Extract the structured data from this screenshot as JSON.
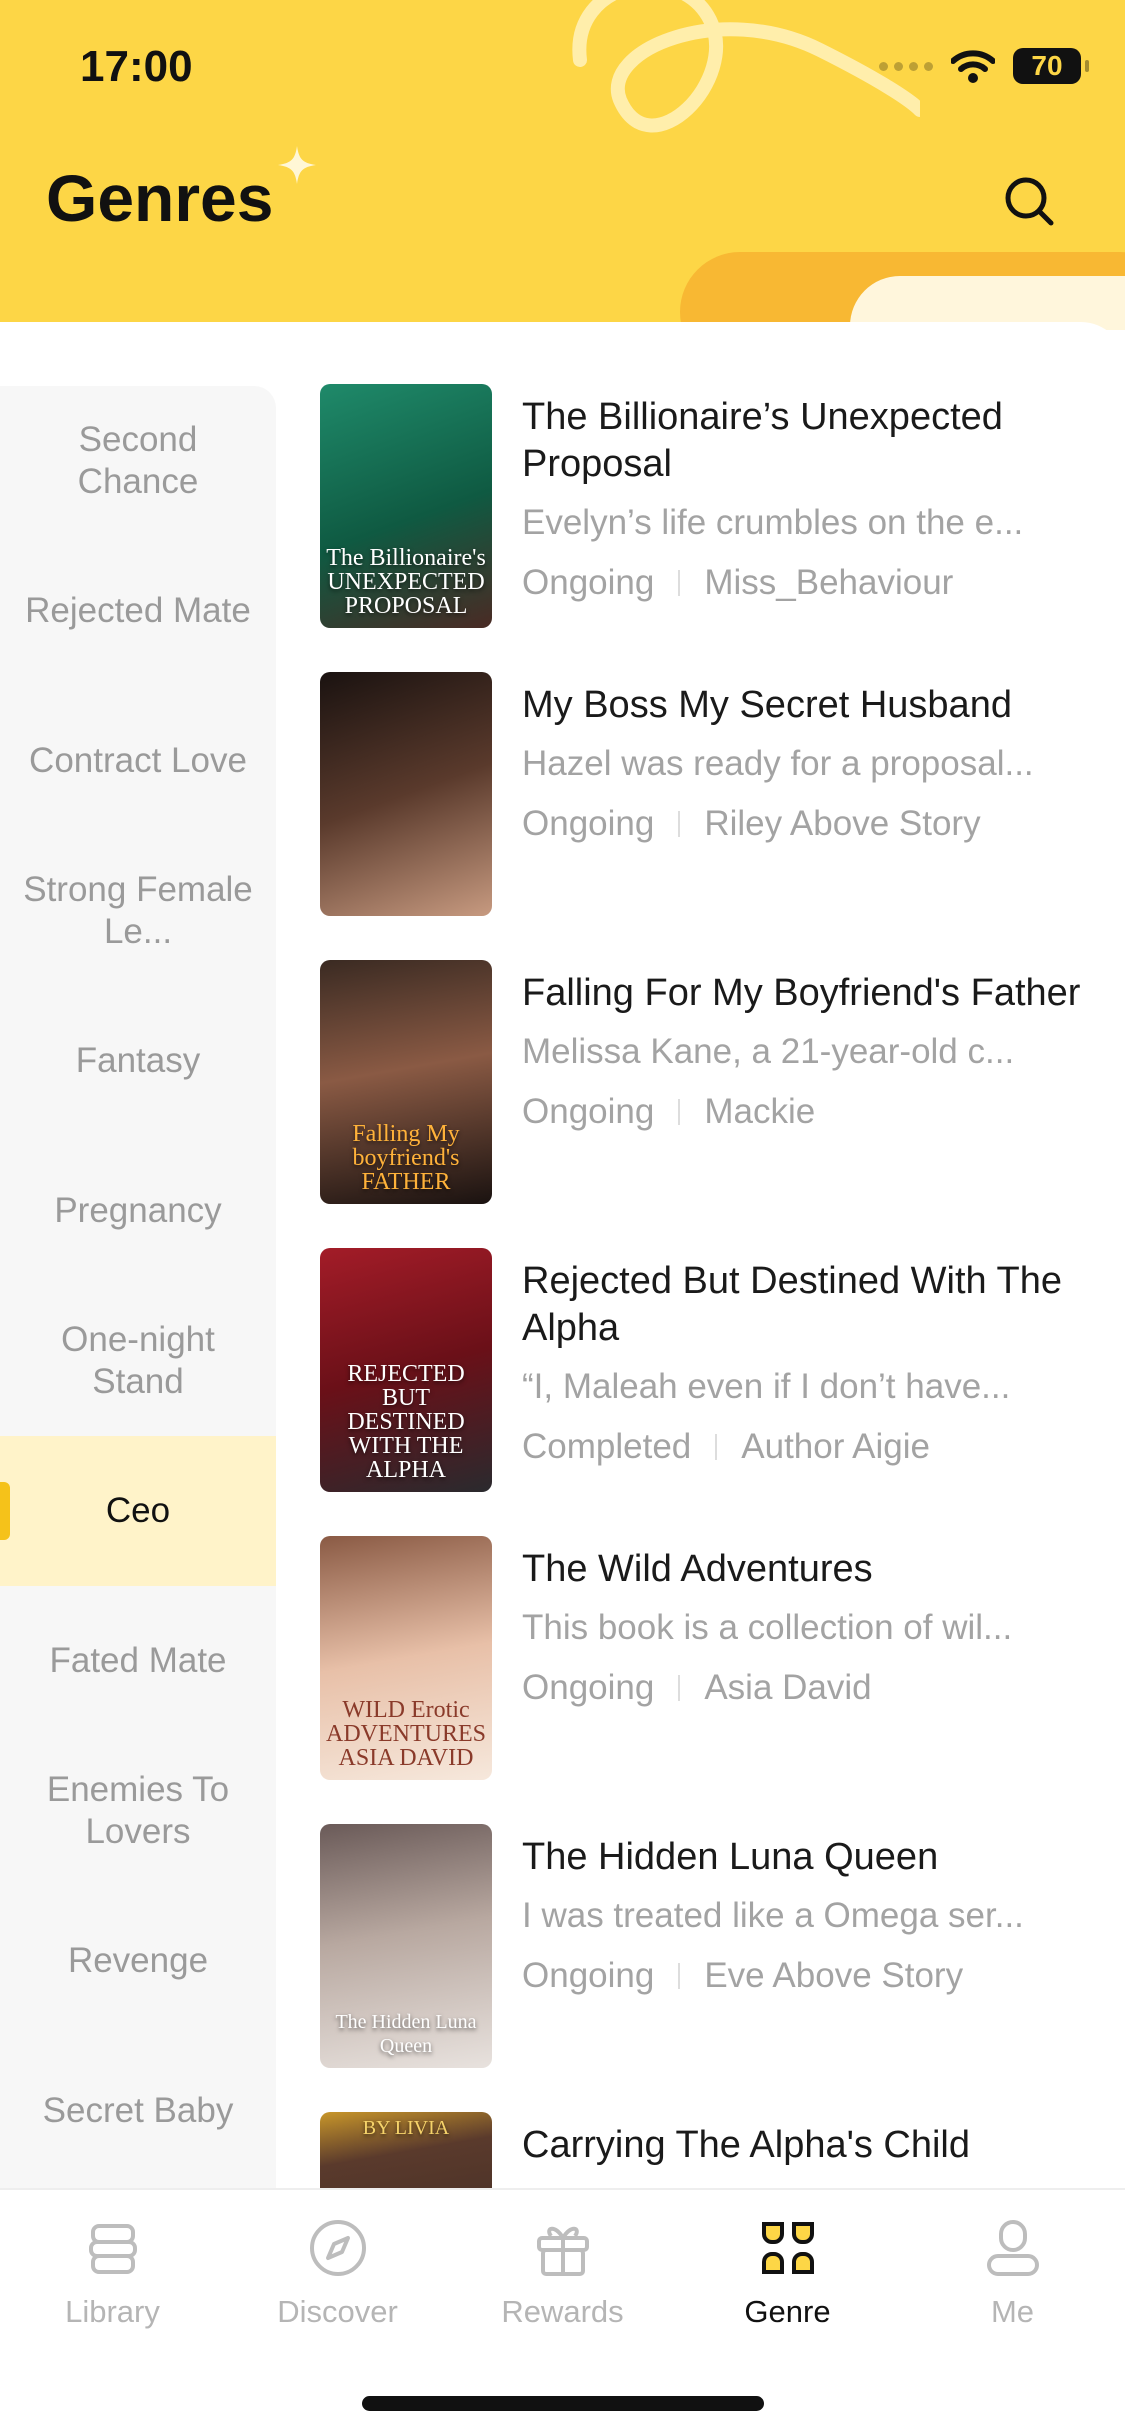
{
  "status_bar": {
    "time": "17:00",
    "battery": "70"
  },
  "header": {
    "title": "Genres"
  },
  "icons": {
    "search": "search-icon",
    "wifi": "wifi-icon",
    "battery": "battery-icon"
  },
  "colors": {
    "accent": "#fdd646",
    "accent_dark": "#f5c21a",
    "active_bg": "#fff3c9",
    "text_muted": "#a3a3a3"
  },
  "genres": [
    {
      "label": "Second Chance",
      "active": false
    },
    {
      "label": "Rejected Mate",
      "active": false
    },
    {
      "label": "Contract Love",
      "active": false
    },
    {
      "label": "Strong Female Le...",
      "active": false
    },
    {
      "label": "Fantasy",
      "active": false
    },
    {
      "label": "Pregnancy",
      "active": false
    },
    {
      "label": "One-night Stand",
      "active": false
    },
    {
      "label": "Ceo",
      "active": true
    },
    {
      "label": "Fated Mate",
      "active": false
    },
    {
      "label": "Enemies To Lovers",
      "active": false
    },
    {
      "label": "Revenge",
      "active": false
    },
    {
      "label": "Secret Baby",
      "active": false
    }
  ],
  "books": [
    {
      "title": "The Billionaire’s Unexpected Proposal",
      "description": "Evelyn’s life crumbles on the e...",
      "status": "Ongoing",
      "author": "Miss_Behaviour",
      "cover_text": "The Billionaire's UNEXPECTED PROPOSAL",
      "cover_color": "#0f6b4f"
    },
    {
      "title": "My Boss My Secret Husband",
      "description": "Hazel was ready for a proposal...",
      "status": "Ongoing",
      "author": "Riley Above Story",
      "cover_text": "",
      "cover_color": "#3a2a24"
    },
    {
      "title": "Falling For My Boyfriend's Father",
      "description": "Melissa Kane,  a 21-year-old c...",
      "status": "Ongoing",
      "author": "Mackie",
      "cover_text": "Falling My boyfriend's FATHER",
      "cover_color": "#2b1d17"
    },
    {
      "title": "Rejected But Destined With The Alpha",
      "description": "“I, Maleah even if I don’t have...",
      "status": "Completed",
      "author": "Author Aigie",
      "cover_text": "REJECTED BUT DESTINED WITH THE ALPHA",
      "cover_color": "#7a1420"
    },
    {
      "title": "The Wild Adventures",
      "description": "This book is a collection of wil...",
      "status": "Ongoing",
      "author": "Asia David",
      "cover_text": "WILD Erotic ADVENTURES ASIA DAVID",
      "cover_color": "#d6a58a"
    },
    {
      "title": "The Hidden Luna Queen",
      "description": "I was treated like a Omega ser...",
      "status": "Ongoing",
      "author": "Eve Above Story",
      "cover_text": "The Hidden Luna Queen",
      "cover_color": "#8a7a78"
    },
    {
      "title": "Carrying The Alpha's Child",
      "description": "",
      "status": "",
      "author": "",
      "cover_text": "BY LIVIA",
      "cover_color": "#2f2420"
    }
  ],
  "bottom_nav": [
    {
      "label": "Library",
      "icon": "library-icon",
      "active": false
    },
    {
      "label": "Discover",
      "icon": "compass-icon",
      "active": false
    },
    {
      "label": "Rewards",
      "icon": "gift-icon",
      "active": false
    },
    {
      "label": "Genre",
      "icon": "genre-grid-icon",
      "active": true
    },
    {
      "label": "Me",
      "icon": "profile-icon",
      "active": false
    }
  ]
}
